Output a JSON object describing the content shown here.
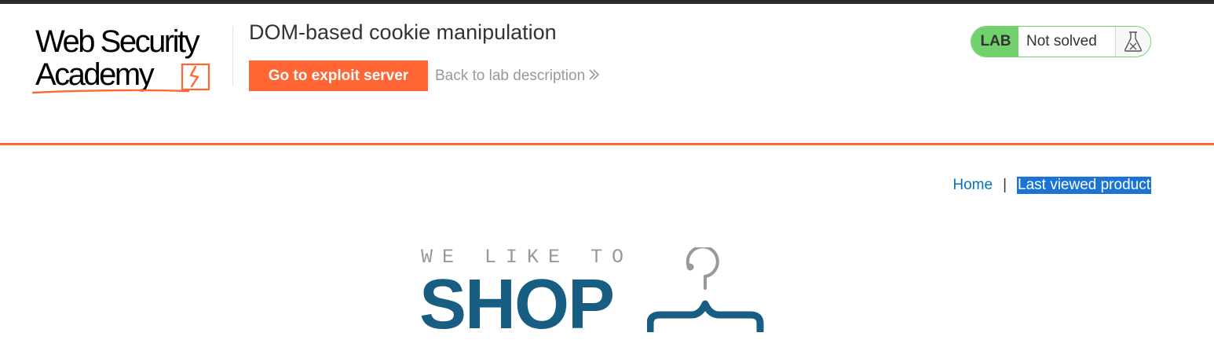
{
  "header": {
    "logo_text_line1": "Web Security",
    "logo_text_line2": "Academy",
    "lab_title": "DOM-based cookie manipulation",
    "exploit_button_label": "Go to exploit server",
    "back_link_label": "Back to lab description",
    "lab_badge_label": "LAB",
    "lab_status_text": "Not solved"
  },
  "nav": {
    "home_label": "Home",
    "separator": "|",
    "last_viewed_label": "Last viewed product"
  },
  "banner": {
    "tagline": "WE LIKE TO",
    "shop_word": "SHOP"
  },
  "colors": {
    "accent_orange": "#ff6633",
    "lab_green": "#70d16d",
    "link_blue": "#0071bc",
    "shop_blue": "#185d82",
    "selection_blue": "#1c73d6"
  },
  "icons": {
    "logo_bolt": "lightning-bolt-icon",
    "back_chevron": "double-chevron-right-icon",
    "flask": "flask-icon",
    "hanger": "clothes-hanger-icon"
  }
}
